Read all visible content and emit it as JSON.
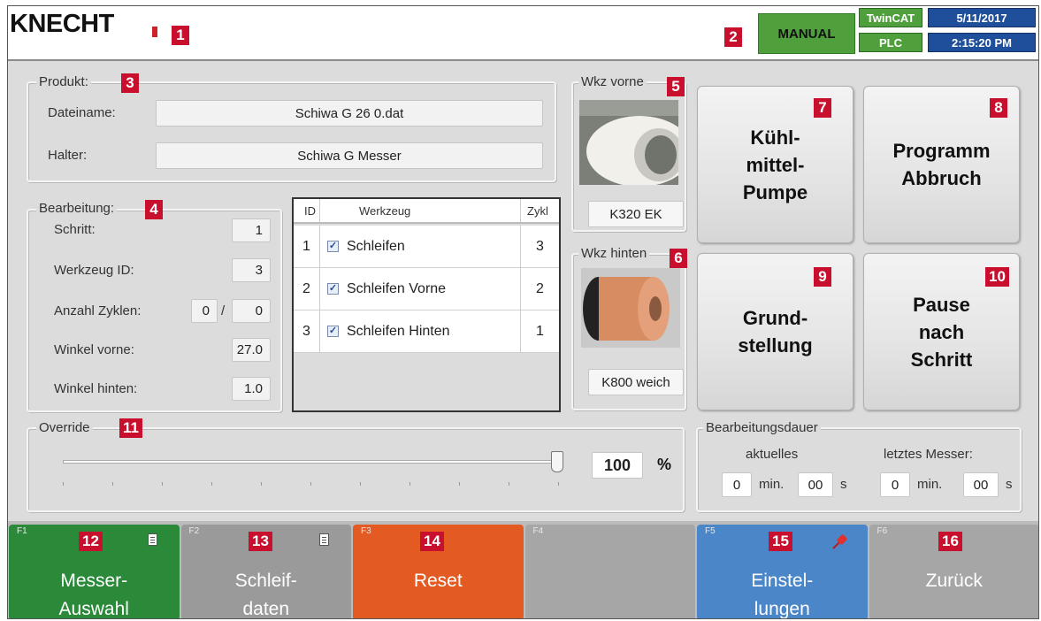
{
  "header": {
    "logo": "KNECHT",
    "mode": "MANUAL",
    "twincat": "TwinCAT",
    "plc": "PLC",
    "date": "5/11/2017",
    "time": "2:15:20 PM"
  },
  "markers": [
    "1",
    "2",
    "3",
    "4",
    "5",
    "6",
    "7",
    "8",
    "9",
    "10",
    "11",
    "12",
    "13",
    "14",
    "15",
    "16"
  ],
  "produkt": {
    "title": "Produkt:",
    "dateiname_label": "Dateiname:",
    "dateiname_value": "Schiwa G 26 0.dat",
    "halter_label": "Halter:",
    "halter_value": "Schiwa G Messer"
  },
  "bearbeitung": {
    "title": "Bearbeitung:",
    "schritt_label": "Schritt:",
    "schritt_value": "1",
    "werkzeug_id_label": "Werkzeug ID:",
    "werkzeug_id_value": "3",
    "zyklen_label": "Anzahl Zyklen:",
    "zyklen_current": "0",
    "zyklen_sep": "/",
    "zyklen_total": "0",
    "winkel_vorne_label": "Winkel vorne:",
    "winkel_vorne_value": "27.0",
    "winkel_hinten_label": "Winkel hinten:",
    "winkel_hinten_value": "1.0"
  },
  "tool_table": {
    "headers": {
      "id": "ID",
      "werkzeug": "Werkzeug",
      "zykl": "Zykl"
    },
    "rows": [
      {
        "id": "1",
        "checked": true,
        "name": "Schleifen",
        "zykl": "3"
      },
      {
        "id": "2",
        "checked": true,
        "name": "Schleifen Vorne",
        "zykl": "2"
      },
      {
        "id": "3",
        "checked": true,
        "name": "Schleifen Hinten",
        "zykl": "1"
      }
    ]
  },
  "wkz_vorne": {
    "title": "Wkz vorne",
    "name": "K320 EK"
  },
  "wkz_hinten": {
    "title": "Wkz hinten",
    "name": "K800 weich"
  },
  "buttons": {
    "kuehlmittel": "Kühl-\nmittel-\nPumpe",
    "abbruch": "Programm\nAbbruch",
    "grundstellung": "Grund-\nstellung",
    "pause": "Pause\nnach\nSchritt"
  },
  "override": {
    "title": "Override",
    "value": "100",
    "unit": "%",
    "level_percent": 100
  },
  "dauer": {
    "title": "Bearbeitungsdauer",
    "aktuelles_label": "aktuelles",
    "letztes_label": "letztes Messer:",
    "akt_min": "0",
    "akt_sec": "00",
    "letzt_min": "0",
    "letzt_sec": "00",
    "min_unit": "min.",
    "sec_unit": "s"
  },
  "fkeys": [
    {
      "key": "F1",
      "label": "Messer-\nAuswahl",
      "color": "#2a8a3a",
      "icon": "document-icon"
    },
    {
      "key": "F2",
      "label": "Schleif-\ndaten",
      "color": "#9a9a9a",
      "icon": "document-icon"
    },
    {
      "key": "F3",
      "label": "Reset",
      "color": "#e35a22",
      "icon": ""
    },
    {
      "key": "F4",
      "label": "",
      "color": "#a6a6a6",
      "icon": ""
    },
    {
      "key": "F5",
      "label": "Einstel-\nlungen",
      "color": "#4a86c8",
      "icon": "pin-icon"
    },
    {
      "key": "F6",
      "label": "Zurück",
      "color": "#a6a6a6",
      "icon": ""
    }
  ],
  "colors": {
    "marker": "#c8102e",
    "mode_bg": "#4fa03c",
    "twincat_bg": "#4fa03c",
    "date_bg": "#1f4f9a"
  }
}
